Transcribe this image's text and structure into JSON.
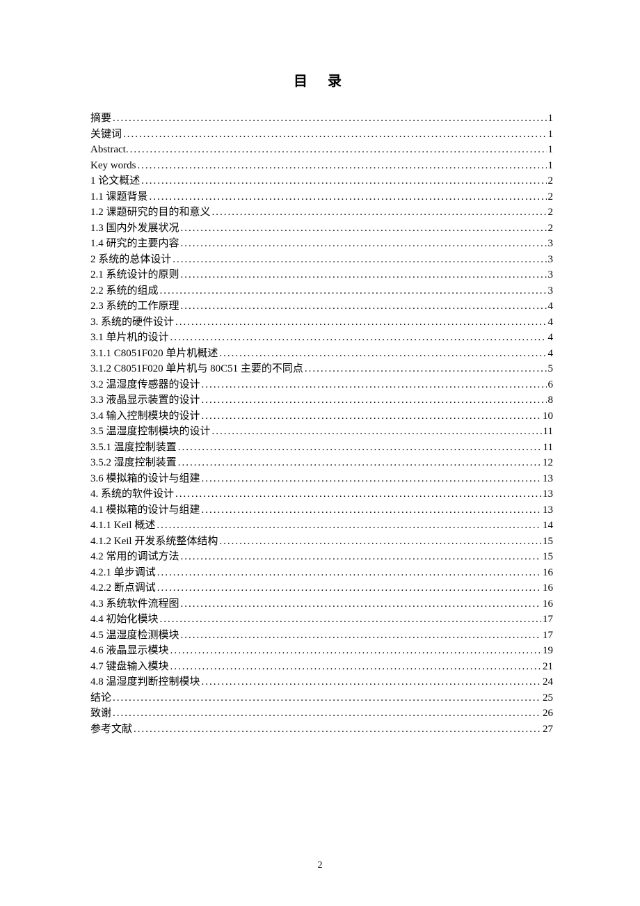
{
  "title": "目  录",
  "page_number": "2",
  "entries": [
    {
      "label": "摘要",
      "page": "1"
    },
    {
      "label": "关键词",
      "page": "1"
    },
    {
      "label": "Abstract.",
      "page": "1"
    },
    {
      "label": "Key words",
      "page": "1"
    },
    {
      "label": "1 论文概述",
      "page": "2"
    },
    {
      "label": "1.1 课题背景",
      "page": "2"
    },
    {
      "label": "1.2 课题研究的目的和意义",
      "page": "2"
    },
    {
      "label": "1.3 国内外发展状况",
      "page": "2"
    },
    {
      "label": "1.4 研究的主要内容",
      "page": "3"
    },
    {
      "label": "2 系统的总体设计",
      "page": "3"
    },
    {
      "label": "2.1  系统设计的原则",
      "page": "3"
    },
    {
      "label": "2.2  系统的组成",
      "page": "3"
    },
    {
      "label": "2.3  系统的工作原理",
      "page": "4"
    },
    {
      "label": "3. 系统的硬件设计",
      "page": "4"
    },
    {
      "label": "3.1 单片机的设计",
      "page": "4"
    },
    {
      "label": "3.1.1 C8051F020 单片机概述",
      "page": "4"
    },
    {
      "label": "3.1.2 C8051F020 单片机与 80C51 主要的不同点",
      "page": "5"
    },
    {
      "label": "3.2  温湿度传感器的设计",
      "page": "6"
    },
    {
      "label": "3.3  液晶显示装置的设计",
      "page": "8"
    },
    {
      "label": "3.4  输入控制模块的设计",
      "page": "10"
    },
    {
      "label": "3.5  温湿度控制模块的设计",
      "page": "11"
    },
    {
      "label": "3.5.1 温度控制装置",
      "page": "11"
    },
    {
      "label": "3.5.2 湿度控制装置",
      "page": "12"
    },
    {
      "label": "3.6 模拟箱的设计与组建",
      "page": "13"
    },
    {
      "label": "4. 系统的软件设计",
      "page": "13"
    },
    {
      "label": "4.1  模拟箱的设计与组建",
      "page": "13"
    },
    {
      "label": "4.1.1 Keil 概述",
      "page": "14"
    },
    {
      "label": "4.1.2 Keil 开发系统整体结构",
      "page": "15"
    },
    {
      "label": "4.2 常用的调试方法",
      "page": "15"
    },
    {
      "label": "4.2.1 单步调试",
      "page": "16"
    },
    {
      "label": "4.2.2 断点调试",
      "page": "16"
    },
    {
      "label": "4.3 系统软件流程图",
      "page": "16"
    },
    {
      "label": "4.4 初始化模块",
      "page": "17"
    },
    {
      "label": "4.5 温湿度检测模块",
      "page": "17"
    },
    {
      "label": "4.6 液晶显示模块",
      "page": "19"
    },
    {
      "label": "4.7 键盘输入模块",
      "page": "21"
    },
    {
      "label": "4.8 温湿度判断控制模块",
      "page": "24"
    },
    {
      "label": "结论",
      "page": "25"
    },
    {
      "label": "致谢",
      "page": "26"
    },
    {
      "label": "参考文献",
      "page": "27"
    }
  ]
}
